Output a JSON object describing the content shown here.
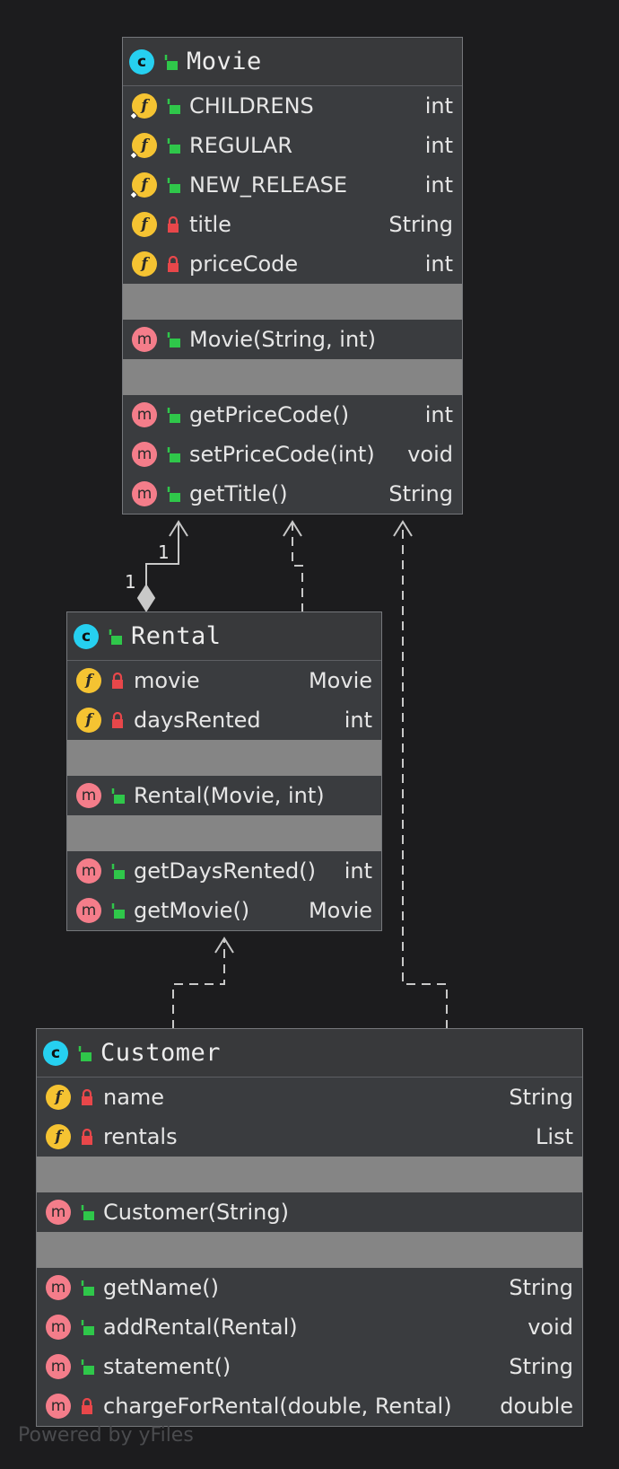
{
  "classes": {
    "movie": {
      "title": "Movie",
      "fields": [
        {
          "name": "CHILDRENS",
          "type": "int"
        },
        {
          "name": "REGULAR",
          "type": "int"
        },
        {
          "name": "NEW_RELEASE",
          "type": "int"
        },
        {
          "name": "title",
          "type": "String"
        },
        {
          "name": "priceCode",
          "type": "int"
        }
      ],
      "constructors": [
        {
          "name": "Movie(String, int)",
          "type": ""
        }
      ],
      "methods": [
        {
          "name": "getPriceCode()",
          "type": "int"
        },
        {
          "name": "setPriceCode(int)",
          "type": "void"
        },
        {
          "name": "getTitle()",
          "type": "String"
        }
      ]
    },
    "rental": {
      "title": "Rental",
      "fields": [
        {
          "name": "movie",
          "type": "Movie"
        },
        {
          "name": "daysRented",
          "type": "int"
        }
      ],
      "constructors": [
        {
          "name": "Rental(Movie, int)",
          "type": ""
        }
      ],
      "methods": [
        {
          "name": "getDaysRented()",
          "type": "int"
        },
        {
          "name": "getMovie()",
          "type": "Movie"
        }
      ]
    },
    "customer": {
      "title": "Customer",
      "fields": [
        {
          "name": "name",
          "type": "String"
        },
        {
          "name": "rentals",
          "type": "List"
        }
      ],
      "constructors": [
        {
          "name": "Customer(String)",
          "type": ""
        }
      ],
      "methods": [
        {
          "name": "getName()",
          "type": "String"
        },
        {
          "name": "addRental(Rental)",
          "type": "void"
        },
        {
          "name": "statement()",
          "type": "String"
        },
        {
          "name": "chargeForRental(double, Rental)",
          "type": "double"
        }
      ]
    }
  },
  "icons": {
    "class_letter": "c",
    "field_letter": "f",
    "method_letter": "m",
    "public_icon": "unlocked-icon",
    "private_icon": "locked-icon"
  },
  "colors": {
    "class_icon": "#26d0f0",
    "field_icon": "#f5c332",
    "method_icon": "#f47d8a",
    "public": "#2fc74a",
    "private": "#e8474a"
  },
  "relations": {
    "composition_multiplicity_target": "1",
    "composition_multiplicity_source": "1"
  },
  "footer": "Powered by yFiles"
}
